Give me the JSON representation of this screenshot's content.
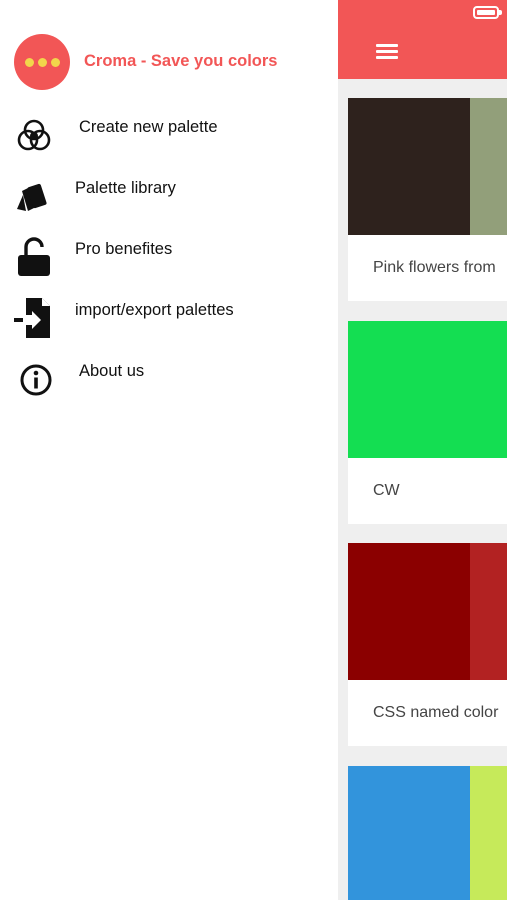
{
  "drawer": {
    "app_title": "Croma - Save you colors",
    "items": [
      {
        "label": "Create new palette",
        "icon": "venn-circles-icon"
      },
      {
        "label": "Palette library",
        "icon": "swatch-cards-icon"
      },
      {
        "label": "Pro benefites",
        "icon": "unlock-icon"
      },
      {
        "label": "import/export palettes",
        "icon": "import-file-icon"
      },
      {
        "label": "About us",
        "icon": "info-icon"
      }
    ]
  },
  "app": {
    "accent": "#f25656",
    "palettes": [
      {
        "title": "Pink flowers from",
        "colors": [
          "#2e221d",
          "#929f7a"
        ]
      },
      {
        "title": "CW",
        "colors": [
          "#14de52"
        ]
      },
      {
        "title": "CSS named color",
        "colors": [
          "#8b0000",
          "#b22222"
        ]
      },
      {
        "title": "",
        "colors": [
          "#3294dc",
          "#c6ea5a"
        ]
      }
    ]
  }
}
